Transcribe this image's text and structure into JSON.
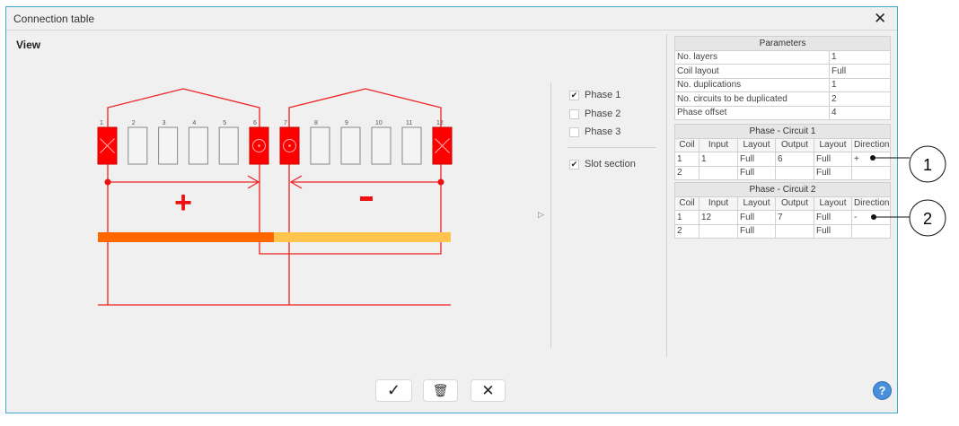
{
  "window": {
    "title": "Connection table",
    "close": "✕"
  },
  "view_label": "View",
  "diagram": {
    "slots": [
      "1",
      "2",
      "3",
      "4",
      "5",
      "6",
      "7",
      "8",
      "9",
      "10",
      "11",
      "12"
    ],
    "active": {
      "1": "cross",
      "6": "dot",
      "7": "dot",
      "12": "cross"
    },
    "signs": [
      "+",
      "-"
    ],
    "colors": {
      "active": "#ff0000",
      "bar1": "#ff6600",
      "bar2": "#ffc44d"
    }
  },
  "options": {
    "phase1": "Phase 1",
    "phase2": "Phase 2",
    "phase3": "Phase 3",
    "slot_section": "Slot section",
    "checked": {
      "phase1": true,
      "phase2": false,
      "phase3": false,
      "slot_section": true
    }
  },
  "parameters": {
    "title": "Parameters",
    "rows": [
      [
        "No. layers",
        "1"
      ],
      [
        "Coil layout",
        "Full"
      ],
      [
        "No. duplications",
        "1"
      ],
      [
        "No. circuits to be duplicated",
        "2"
      ],
      [
        "Phase offset",
        "4"
      ]
    ]
  },
  "circuits": [
    {
      "title": "Phase - Circuit 1",
      "headers": [
        "Coil",
        "Input",
        "Layout",
        "Output",
        "Layout",
        "Direction"
      ],
      "rows": [
        [
          "1",
          "1",
          "Full",
          "6",
          "Full",
          "+"
        ],
        [
          "2",
          "",
          "Full",
          "",
          "Full",
          ""
        ]
      ]
    },
    {
      "title": "Phase - Circuit 2",
      "headers": [
        "Coil",
        "Input",
        "Layout",
        "Output",
        "Layout",
        "Direction"
      ],
      "rows": [
        [
          "1",
          "12",
          "Full",
          "7",
          "Full",
          "-"
        ],
        [
          "2",
          "",
          "Full",
          "",
          "Full",
          ""
        ]
      ]
    }
  ],
  "callouts": [
    "1",
    "2"
  ],
  "footer": {
    "ok": "✓",
    "delete": "🗑",
    "cancel": "✕",
    "help": "?"
  }
}
